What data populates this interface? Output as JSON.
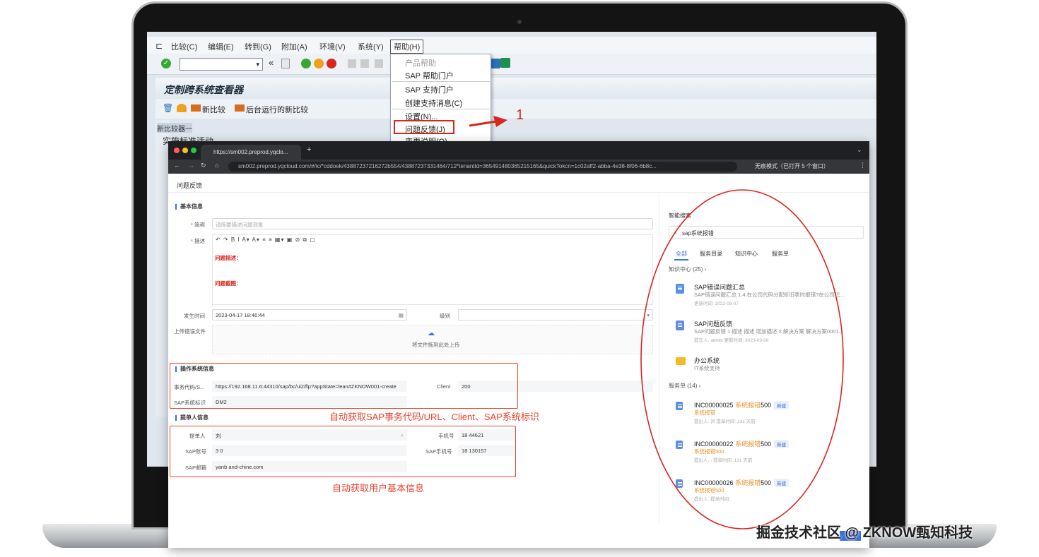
{
  "sap": {
    "menus": [
      "比较(C)",
      "编辑(E)",
      "转到(G)",
      "附加(A)",
      "环境(V)",
      "系统(Y)",
      "帮助(H)"
    ],
    "title": "定制跨系统查看器",
    "app_toolbar": [
      "新比较",
      "后台运行的新比较"
    ],
    "tree_header": "新比较器一",
    "tree_text": "实施标准活动",
    "help_menu": [
      "产品帮助",
      "SAP 帮助门户",
      "SAP 支持门户",
      "创建支持消息(C)",
      "设置(N)...",
      "问题反馈(J)",
      "变更说明(O)"
    ],
    "arrow_label": "1"
  },
  "browser": {
    "tab_title": "https://sm002.preprod.yqclo...",
    "url": "sm002.preprod.yqcloud.com/#/ic/*cddoek/43887237216272b554/43887237331464/712*tenantId=365491480365215165&quickTokcn=1c02aff2-abba-4e38-8f06-6b8c...",
    "incognito": "无痕模式（已打开 5 个窗口）"
  },
  "form": {
    "page_title": "问题反馈",
    "section_basic": "基本信息",
    "label_summary": "简称",
    "summary_placeholder": "请简要描述问题现象",
    "label_description": "描述",
    "editor_toolbar": "↶ ↷  B  I  A▾  A▾  ≡ ≡  ▦▾  ▣  ⊘  ⧉  ▢",
    "desc_problem": "问题描述：",
    "desc_screenshot": "问题截图：",
    "label_time": "发生时间",
    "time_value": "2023-04-17 18:46:44",
    "label_level": "级别",
    "label_attach": "上传错误文件",
    "upload_text": "将文件拖到此处上传",
    "section_system": "操作系统信息",
    "label_tcode": "事务代码/S...",
    "tcode_value": "https://192.168.11.6:44310/sap/bc/ui2/flp?appState=lean#ZKNOW001-create",
    "label_client": "Client",
    "client_value": "200",
    "label_sapsys": "SAP系统标识",
    "sapsys_value": "DM2",
    "annotation_system": "自动获取SAP事务代码/URL、Client、SAP系统标识",
    "section_submitter": "提单人信息",
    "label_submitter": "提单人",
    "submitter_value": "刘",
    "label_phone": "手机号",
    "phone_value": "18     44621",
    "label_sap_account": "SAP账号",
    "sap_account_value": "3     0",
    "label_sap_phone": "SAP手机号",
    "sap_phone_value": "18     130157",
    "label_sap_email": "SAP邮箱",
    "sap_email_value": "yanb              and-chine.com",
    "annotation_user": "自动获取用户基本信息"
  },
  "smart": {
    "title": "智能搜索",
    "search_value": "sap系统报错",
    "tabs": [
      "全部",
      "服务目录",
      "知识中心",
      "服务单"
    ],
    "knowledge_header": "知识中心 (25) ›",
    "knowledge": [
      {
        "title": "SAP错误问题汇总",
        "snippet": "SAP错误问题汇总 1.4.在公司代码分配折旧表时报错?在公司代...",
        "meta": "更新时间: 2022-09-07"
      },
      {
        "title": "SAP问题反馈",
        "snippet": "SAP问题反馈 1.描述 描述 增加描述 2.解决方案 解决方案0001...",
        "meta": "提交人: admin  更新时间: 2023-03-08"
      },
      {
        "title": "办公系统",
        "snippet": "IT系统支持",
        "meta": ""
      }
    ],
    "tickets_header": "服务单 (14) ›",
    "tickets": [
      {
        "id": "INC00000025",
        "kw": "系统报错",
        "num": "500",
        "badge": "新建",
        "sub": "系统报错",
        "meta": "提出人: 刘  提单时间: 131 天前"
      },
      {
        "id": "INC00000022",
        "kw": "系统报错",
        "num": "500",
        "badge": "新建",
        "sub": "系统报错500",
        "meta": "提出人: -  提单时间: 131 天前"
      },
      {
        "id": "INC00000026",
        "kw": "系统报错",
        "num": "500",
        "badge": "新建",
        "sub": "系统报错500",
        "meta": "提出人:    提单时间:"
      }
    ]
  },
  "watermark": "掘金技术社区 @ ZKNOW甄知科技",
  "colors": {
    "annotation_red": "#e8432f",
    "accent_blue": "#3b6fe0"
  }
}
